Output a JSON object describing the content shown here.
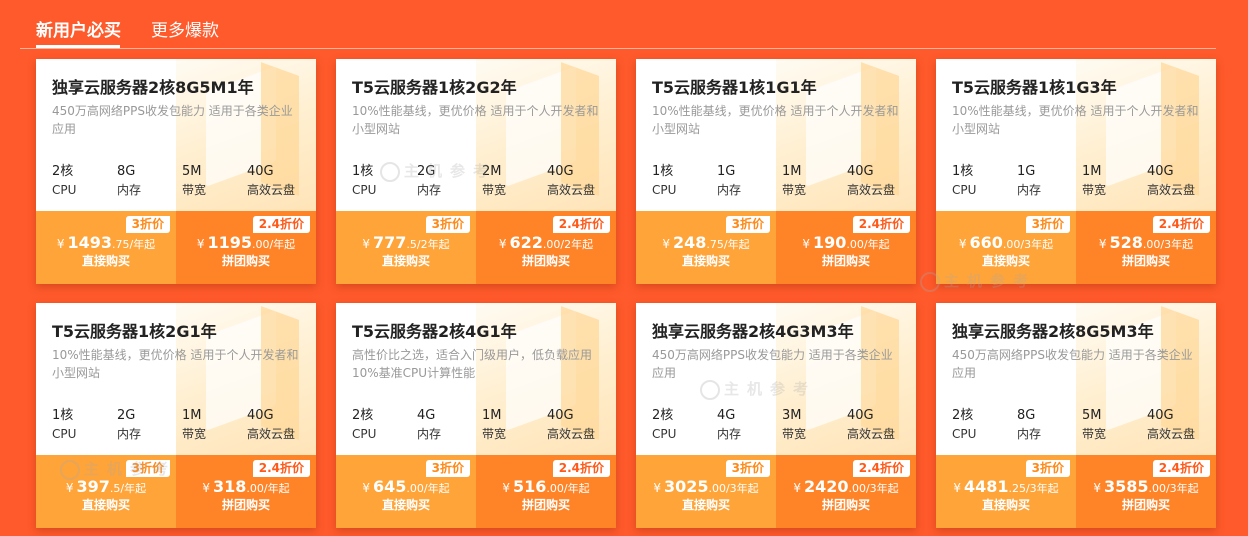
{
  "tabs": [
    {
      "label": "新用户必买",
      "active": true
    },
    {
      "label": "更多爆款",
      "active": false
    }
  ],
  "watermark": "主机参考",
  "spec_labels": [
    "CPU",
    "内存",
    "带宽",
    "高效云盘"
  ],
  "colors": {
    "background": "#ff5a2b",
    "single_buy": "#ffa439",
    "group_buy": "#ff8428"
  },
  "cards": [
    {
      "title": "独享云服务器2核8G5M1年",
      "desc": "450万高网络PPS收发包能力 适用于各类企业应用",
      "specs": [
        "2核",
        "8G",
        "5M",
        "40G"
      ],
      "single": {
        "badge": "3折价",
        "currency": "¥",
        "price": "1493",
        "suffix": ".75/年起",
        "action": "直接购买"
      },
      "group": {
        "badge": "2.4折价",
        "currency": "¥",
        "price": "1195",
        "suffix": ".00/年起",
        "action": "拼团购买"
      }
    },
    {
      "title": "T5云服务器1核2G2年",
      "desc": "10%性能基线，更优价格 适用于个人开发者和小型网站",
      "specs": [
        "1核",
        "2G",
        "2M",
        "40G"
      ],
      "single": {
        "badge": "3折价",
        "currency": "¥",
        "price": "777",
        "suffix": ".5/2年起",
        "action": "直接购买"
      },
      "group": {
        "badge": "2.4折价",
        "currency": "¥",
        "price": "622",
        "suffix": ".00/2年起",
        "action": "拼团购买"
      }
    },
    {
      "title": "T5云服务器1核1G1年",
      "desc": "10%性能基线，更优价格 适用于个人开发者和小型网站",
      "specs": [
        "1核",
        "1G",
        "1M",
        "40G"
      ],
      "single": {
        "badge": "3折价",
        "currency": "¥",
        "price": "248",
        "suffix": ".75/年起",
        "action": "直接购买"
      },
      "group": {
        "badge": "2.4折价",
        "currency": "¥",
        "price": "190",
        "suffix": ".00/年起",
        "action": "拼团购买"
      }
    },
    {
      "title": "T5云服务器1核1G3年",
      "desc": "10%性能基线，更优价格 适用于个人开发者和小型网站",
      "specs": [
        "1核",
        "1G",
        "1M",
        "40G"
      ],
      "single": {
        "badge": "3折价",
        "currency": "¥",
        "price": "660",
        "suffix": ".00/3年起",
        "action": "直接购买"
      },
      "group": {
        "badge": "2.4折价",
        "currency": "¥",
        "price": "528",
        "suffix": ".00/3年起",
        "action": "拼团购买"
      }
    },
    {
      "title": "T5云服务器1核2G1年",
      "desc": "10%性能基线，更优价格 适用于个人开发者和小型网站",
      "specs": [
        "1核",
        "2G",
        "1M",
        "40G"
      ],
      "single": {
        "badge": "3折价",
        "currency": "¥",
        "price": "397",
        "suffix": ".5/年起",
        "action": "直接购买"
      },
      "group": {
        "badge": "2.4折价",
        "currency": "¥",
        "price": "318",
        "suffix": ".00/年起",
        "action": "拼团购买"
      }
    },
    {
      "title": "T5云服务器2核4G1年",
      "desc": "高性价比之选，适合入门级用户，低负载应用10%基准CPU计算性能",
      "specs": [
        "2核",
        "4G",
        "1M",
        "40G"
      ],
      "single": {
        "badge": "3折价",
        "currency": "¥",
        "price": "645",
        "suffix": ".00/年起",
        "action": "直接购买"
      },
      "group": {
        "badge": "2.4折价",
        "currency": "¥",
        "price": "516",
        "suffix": ".00/年起",
        "action": "拼团购买"
      }
    },
    {
      "title": "独享云服务器2核4G3M3年",
      "desc": "450万高网络PPS收发包能力 适用于各类企业应用",
      "specs": [
        "2核",
        "4G",
        "3M",
        "40G"
      ],
      "single": {
        "badge": "3折价",
        "currency": "¥",
        "price": "3025",
        "suffix": ".00/3年起",
        "action": "直接购买"
      },
      "group": {
        "badge": "2.4折价",
        "currency": "¥",
        "price": "2420",
        "suffix": ".00/3年起",
        "action": "拼团购买"
      }
    },
    {
      "title": "独享云服务器2核8G5M3年",
      "desc": "450万高网络PPS收发包能力 适用于各类企业应用",
      "specs": [
        "2核",
        "8G",
        "5M",
        "40G"
      ],
      "single": {
        "badge": "3折价",
        "currency": "¥",
        "price": "4481",
        "suffix": ".25/3年起",
        "action": "直接购买"
      },
      "group": {
        "badge": "2.4折价",
        "currency": "¥",
        "price": "3585",
        "suffix": ".00/3年起",
        "action": "拼团购买"
      }
    }
  ]
}
